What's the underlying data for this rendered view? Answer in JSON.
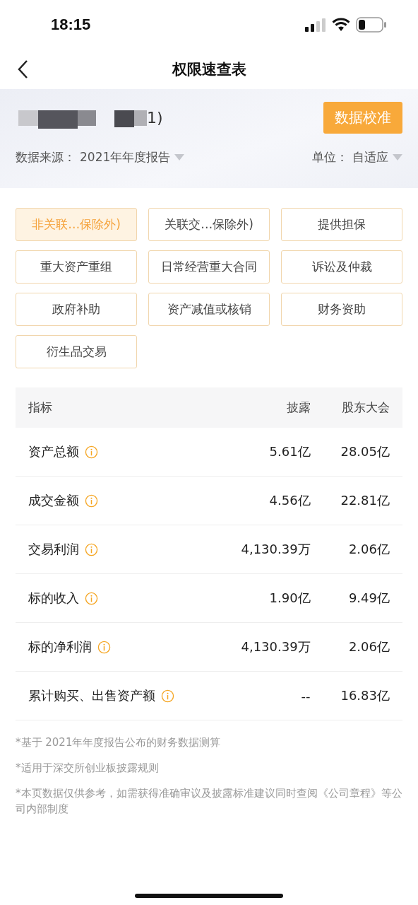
{
  "status_bar": {
    "time": "18:15"
  },
  "nav": {
    "title": "权限速查表"
  },
  "header": {
    "company_name": "1)",
    "calibrate_button": "数据校准",
    "source_label": "数据来源：",
    "source_value": "2021年年度报告",
    "unit_label": "单位：",
    "unit_value": "自适应"
  },
  "categories": [
    {
      "label": "非关联…保除外)",
      "selected": true
    },
    {
      "label": "关联交…保除外)",
      "selected": false
    },
    {
      "label": "提供担保",
      "selected": false
    },
    {
      "label": "重大资产重组",
      "selected": false
    },
    {
      "label": "日常经营重大合同",
      "selected": false
    },
    {
      "label": "诉讼及仲裁",
      "selected": false
    },
    {
      "label": "政府补助",
      "selected": false
    },
    {
      "label": "资产减值或核销",
      "selected": false
    },
    {
      "label": "财务资助",
      "selected": false
    },
    {
      "label": "衍生品交易",
      "selected": false
    }
  ],
  "table": {
    "columns": [
      "指标",
      "披露",
      "股东大会"
    ],
    "rows": [
      {
        "name": "资产总额",
        "disclosure": "5.61亿",
        "meeting": "28.05亿"
      },
      {
        "name": "成交金额",
        "disclosure": "4.56亿",
        "meeting": "22.81亿"
      },
      {
        "name": "交易利润",
        "disclosure": "4,130.39万",
        "meeting": "2.06亿"
      },
      {
        "name": "标的收入",
        "disclosure": "1.90亿",
        "meeting": "9.49亿"
      },
      {
        "name": "标的净利润",
        "disclosure": "4,130.39万",
        "meeting": "2.06亿"
      },
      {
        "name": "累计购买、出售资产额",
        "disclosure": "--",
        "meeting": "16.83亿"
      }
    ]
  },
  "footnotes": [
    "*基于 2021年年度报告公布的财务数据测算",
    "*适用于深交所创业板披露规则",
    "*本页数据仅供参考，如需获得准确审议及披露标准建议同时查阅《公司章程》等公司内部制度"
  ]
}
